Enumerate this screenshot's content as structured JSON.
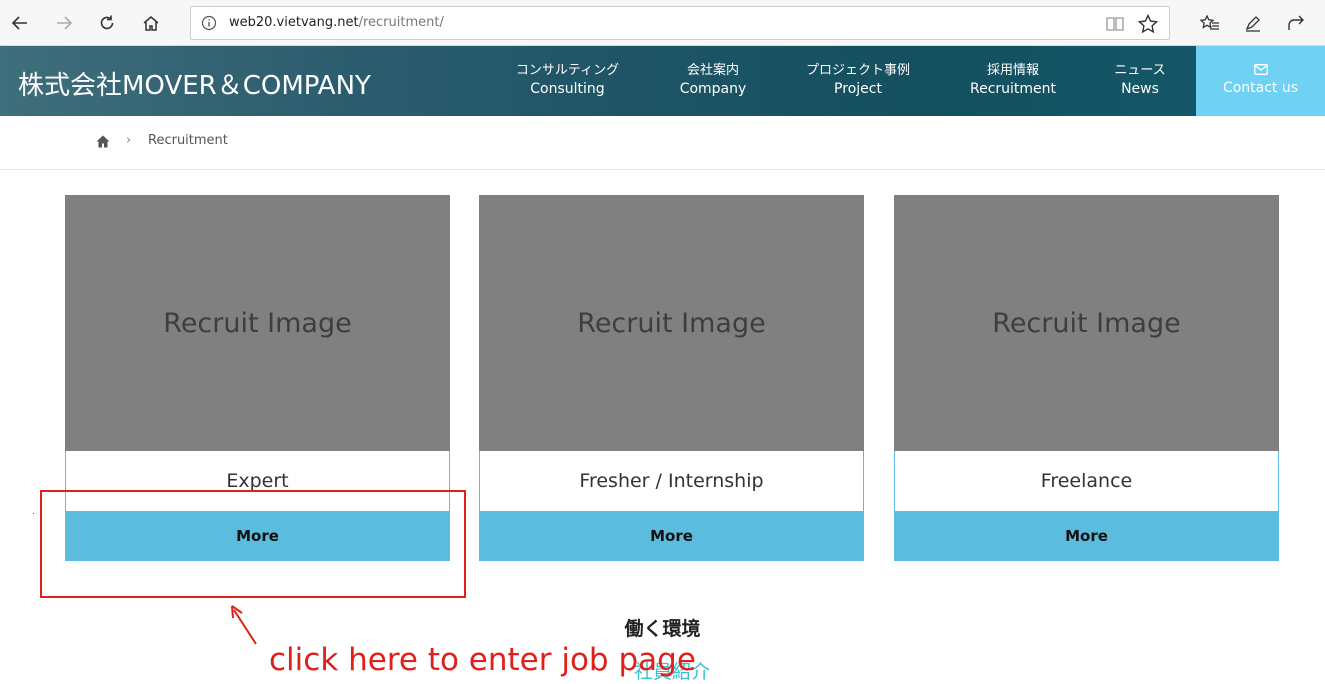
{
  "browser": {
    "url_host": "web20.vietvang.net",
    "url_path": "/recruitment/"
  },
  "header": {
    "brand": "株式会社MOVER＆COMPANY",
    "menu": [
      {
        "jp": "コンサルティング",
        "en": "Consulting"
      },
      {
        "jp": "会社案内",
        "en": "Company"
      },
      {
        "jp": "プロジェクト事例",
        "en": "Project"
      },
      {
        "jp": "採用情報",
        "en": "Recruitment"
      },
      {
        "jp": "ニュース",
        "en": "News"
      }
    ],
    "contact_label": "Contact us"
  },
  "breadcrumb": {
    "current": "Recruitment",
    "separator": ">"
  },
  "cards": [
    {
      "image_text": "Recruit Image",
      "title": "Expert",
      "button": "More"
    },
    {
      "image_text": "Recruit Image",
      "title": "Fresher / Internship",
      "button": "More"
    },
    {
      "image_text": "Recruit Image",
      "title": "Freelance",
      "button": "More"
    }
  ],
  "sections": {
    "work_environment": "働く環境",
    "staff_intro": "社員紹介"
  },
  "annotation": {
    "text": "click here to enter job page",
    "color": "#e0201b"
  },
  "colors": {
    "accent": "#5bbcde",
    "contact_bg": "#6fd1f3",
    "header_bg": "#1f5567"
  }
}
